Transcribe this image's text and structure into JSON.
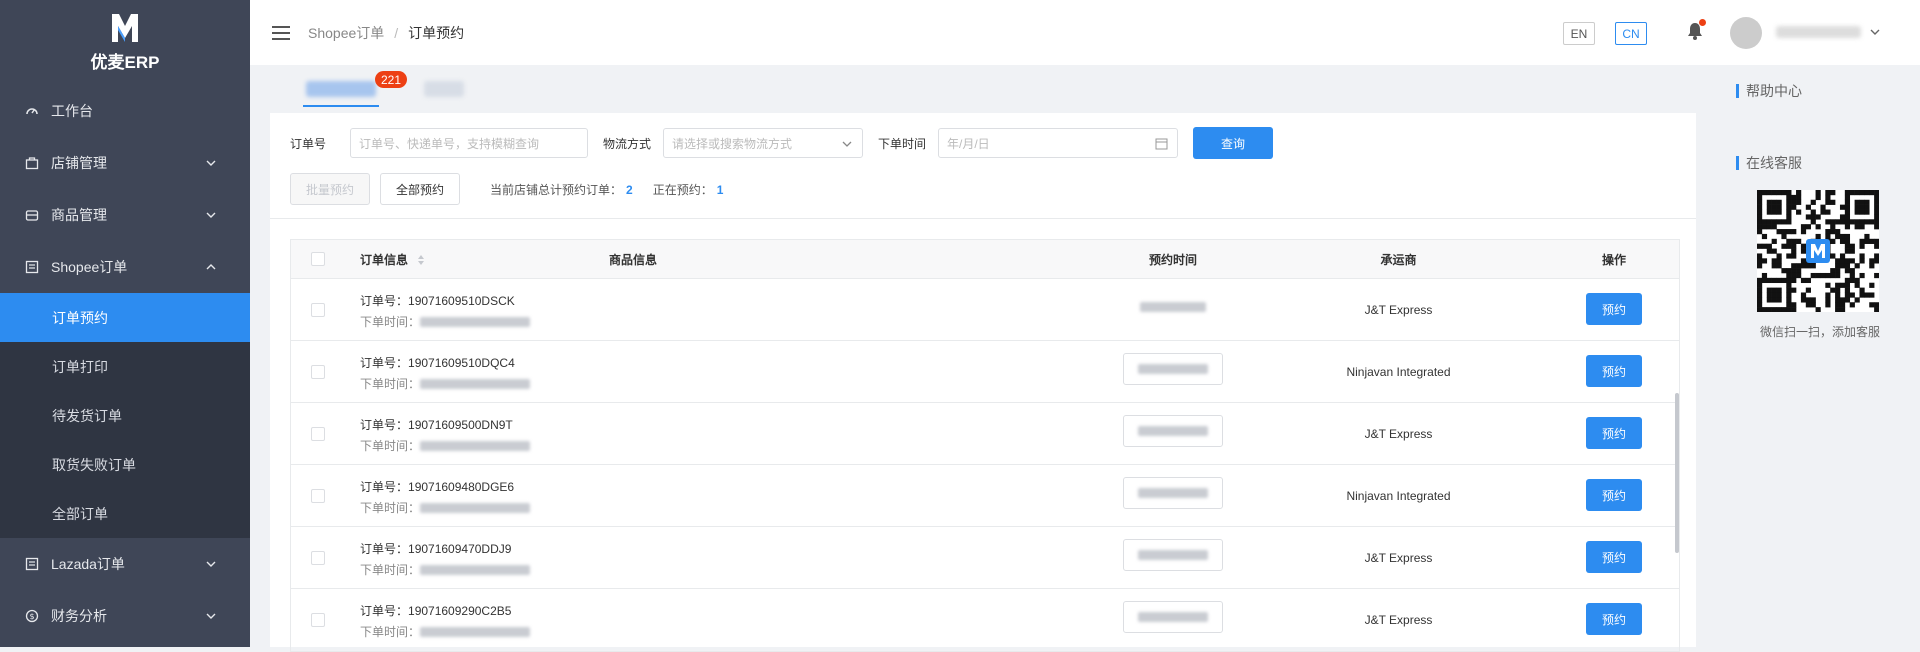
{
  "app": {
    "name": "优麦ERP"
  },
  "sidebar": {
    "items": [
      {
        "label": "工作台",
        "icon": "dashboard-icon"
      },
      {
        "label": "店铺管理",
        "icon": "store-icon"
      },
      {
        "label": "商品管理",
        "icon": "product-icon"
      },
      {
        "label": "Shopee订单",
        "icon": "order-icon"
      }
    ],
    "shopee_sub": [
      {
        "label": "订单预约"
      },
      {
        "label": "订单打印"
      },
      {
        "label": "待发货订单"
      },
      {
        "label": "取货失败订单"
      },
      {
        "label": "全部订单"
      }
    ],
    "bottom_items": [
      {
        "label": "Lazada订单",
        "icon": "order-icon"
      },
      {
        "label": "财务分析",
        "icon": "finance-icon"
      }
    ]
  },
  "header": {
    "breadcrumb": [
      "Shopee订单",
      "订单预约"
    ],
    "separator": "/",
    "lang_en": "EN",
    "lang_cn": "CN"
  },
  "tabs": {
    "badge": "221"
  },
  "filters": {
    "order_label": "订单号",
    "order_placeholder": "订单号、快递单号，支持模糊查询",
    "logistics_label": "物流方式",
    "logistics_placeholder": "请选择或搜索物流方式",
    "date_label": "下单时间",
    "date_placeholder": "年/月/日",
    "query_button": "查询"
  },
  "actions": {
    "batch_button": "批量预约",
    "all_button": "全部预约",
    "stat_total_label": "当前店铺总计预约订单：",
    "stat_total_value": "2",
    "stat_running_label": "正在预约：",
    "stat_running_value": "1"
  },
  "table": {
    "headers": [
      "订单信息",
      "商品信息",
      "预约时间",
      "承运商",
      "操作"
    ],
    "order_prefix": "订单号：",
    "time_prefix": "下单时间：",
    "action_label": "预约",
    "rows": [
      {
        "order_no": "19071609510DSCK",
        "carrier": "J&T Express"
      },
      {
        "order_no": "19071609510DQC4",
        "carrier": "Ninjavan Integrated"
      },
      {
        "order_no": "19071609500DN9T",
        "carrier": "J&T Express"
      },
      {
        "order_no": "19071609480DGE6",
        "carrier": "Ninjavan Integrated"
      },
      {
        "order_no": "19071609470DDJ9",
        "carrier": "J&T Express"
      },
      {
        "order_no": "19071609290C2B5",
        "carrier": "J&T Express"
      }
    ]
  },
  "right_panel": {
    "help_title": "帮助中心",
    "service_title": "在线客服",
    "qr_caption": "微信扫一扫，添加客服"
  },
  "colors": {
    "accent": "#2d8cf0",
    "sidebar": "#3f4657",
    "badge": "#ed4014"
  }
}
